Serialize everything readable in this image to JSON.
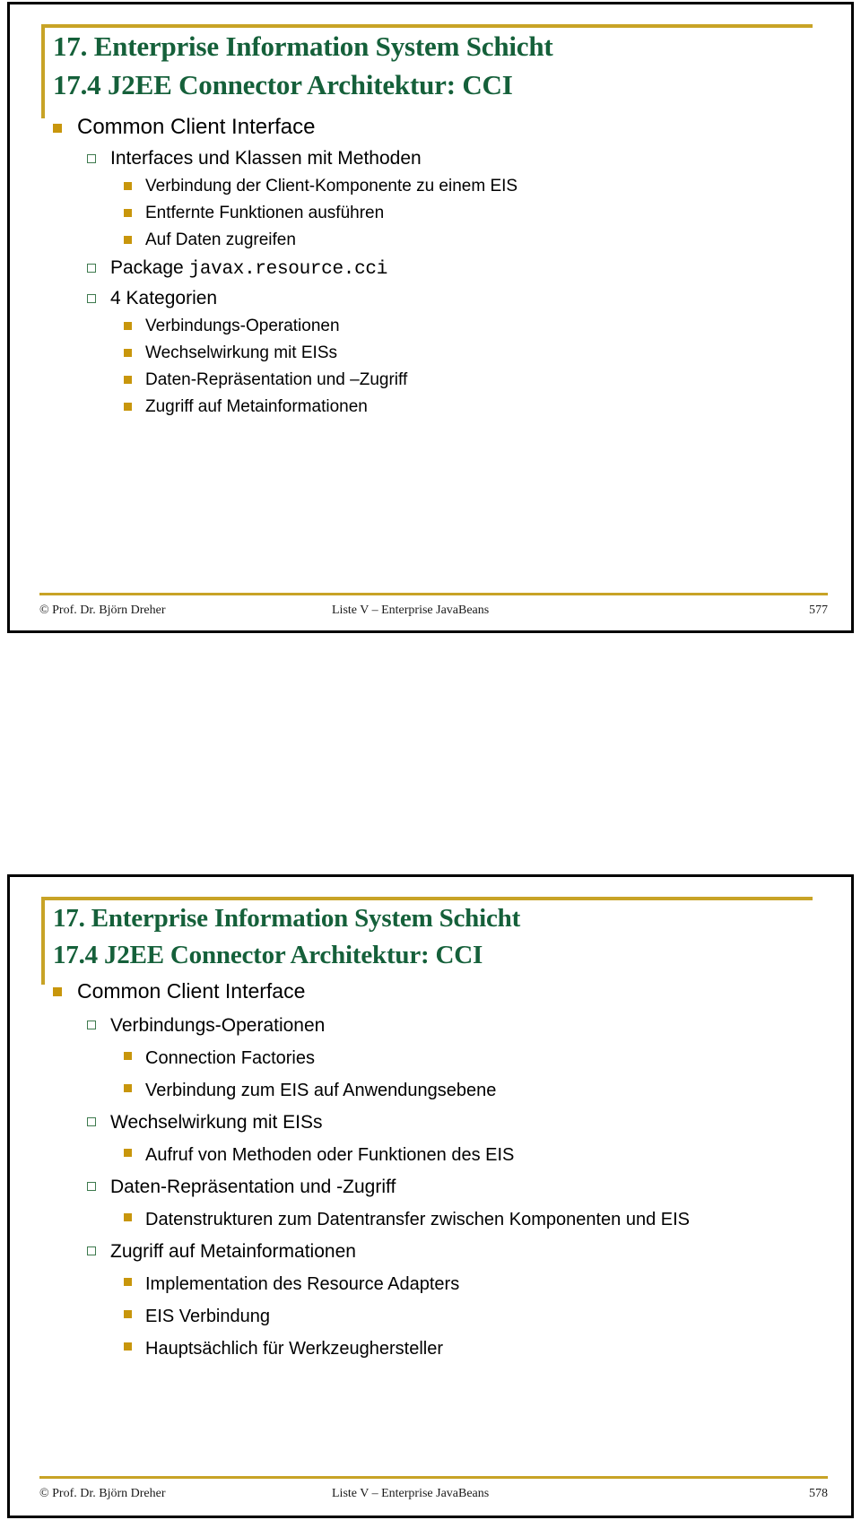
{
  "colors": {
    "title_green": "#15603A",
    "accent_gold": "#C8A326",
    "bullet_gold": "#C8960C",
    "bullet_green_outline": "#3E7A4E",
    "frame_black": "#000000"
  },
  "slides": [
    {
      "title_line_1": "17. Enterprise Information System Schicht",
      "title_line_2": "17.4 J2EE Connector Architektur: CCI",
      "bullets": [
        {
          "level": 1,
          "text": "Common Client Interface"
        },
        {
          "level": 2,
          "text": "Interfaces und Klassen mit Methoden"
        },
        {
          "level": 3,
          "text": "Verbindung der Client-Komponente zu einem EIS"
        },
        {
          "level": 3,
          "text": "Entfernte Funktionen ausführen"
        },
        {
          "level": 3,
          "text": "Auf Daten zugreifen"
        },
        {
          "level": 2,
          "text": "Package ",
          "mono": "javax.resource.cci"
        },
        {
          "level": 2,
          "text": "4 Kategorien"
        },
        {
          "level": 3,
          "text": "Verbindungs-Operationen"
        },
        {
          "level": 3,
          "text": "Wechselwirkung mit EISs"
        },
        {
          "level": 3,
          "text": "Daten-Repräsentation und –Zugriff"
        },
        {
          "level": 3,
          "text": "Zugriff auf Metainformationen"
        }
      ],
      "footer": {
        "left": "© Prof. Dr. Björn Dreher",
        "middle": "Liste V – Enterprise JavaBeans",
        "page": "577"
      }
    },
    {
      "title_line_1": "17. Enterprise Information System Schicht",
      "title_line_2": "17.4 J2EE Connector Architektur: CCI",
      "bullets": [
        {
          "level": 1,
          "text": "Common Client Interface"
        },
        {
          "level": 2,
          "text": "Verbindungs-Operationen"
        },
        {
          "level": 3,
          "text": "Connection Factories"
        },
        {
          "level": 3,
          "text": "Verbindung zum EIS auf Anwendungsebene"
        },
        {
          "level": 2,
          "text": "Wechselwirkung mit EISs"
        },
        {
          "level": 3,
          "text": "Aufruf von Methoden oder Funktionen des EIS"
        },
        {
          "level": 2,
          "text": "Daten-Repräsentation und -Zugriff"
        },
        {
          "level": 3,
          "text": "Datenstrukturen zum Datentransfer zwischen Komponenten und EIS"
        },
        {
          "level": 2,
          "text": "Zugriff auf Metainformationen"
        },
        {
          "level": 3,
          "text": "Implementation des Resource Adapters"
        },
        {
          "level": 3,
          "text": "EIS Verbindung"
        },
        {
          "level": 3,
          "text": "Hauptsächlich für Werkzeughersteller"
        }
      ],
      "footer": {
        "left": "© Prof. Dr. Björn Dreher",
        "middle": "Liste V – Enterprise JavaBeans",
        "page": "578"
      }
    }
  ]
}
